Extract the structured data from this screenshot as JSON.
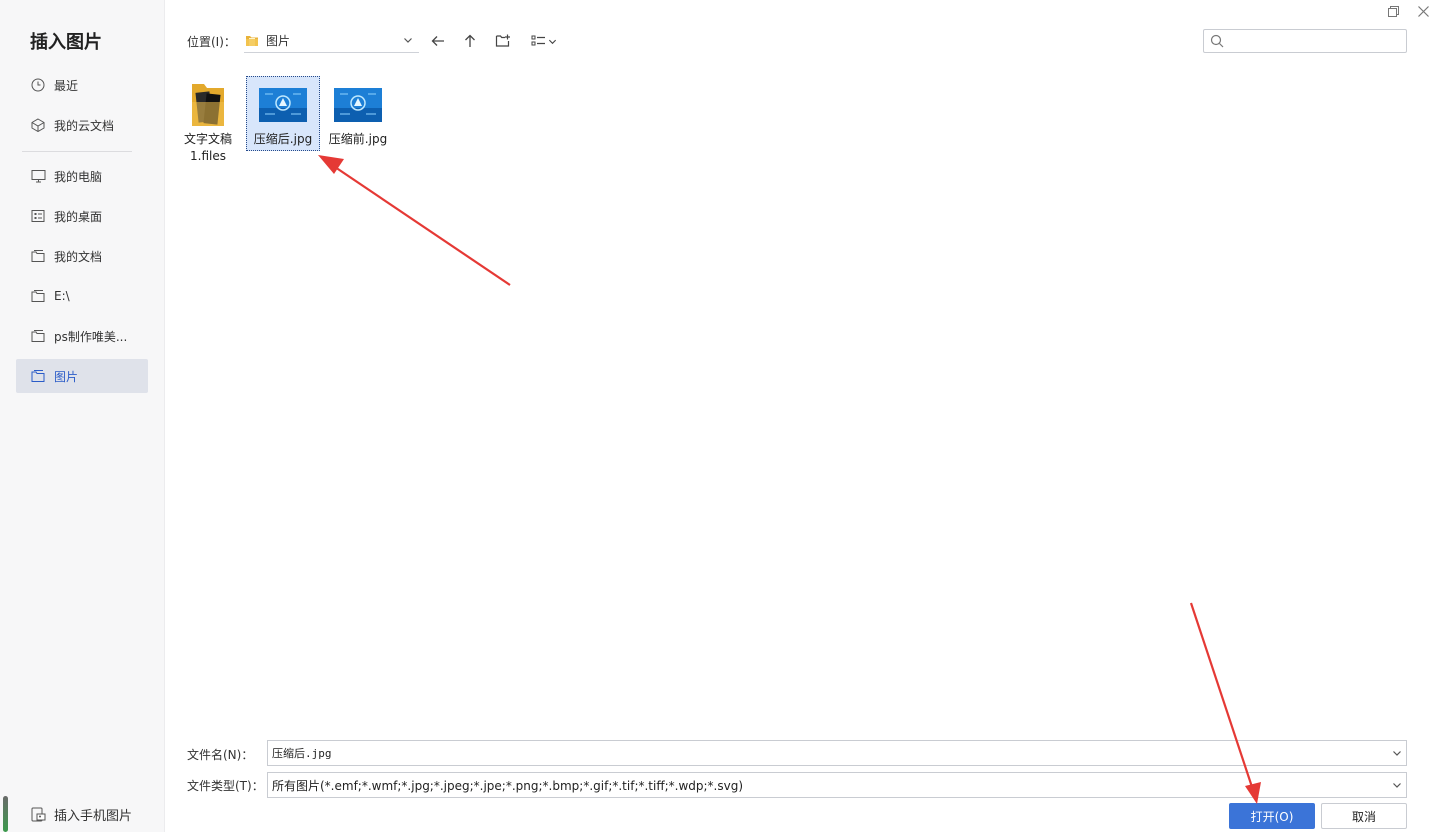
{
  "dialog": {
    "title": "插入图片"
  },
  "sidebar": {
    "items": [
      {
        "label": "最近",
        "icon": "clock-icon"
      },
      {
        "label": "我的云文档",
        "icon": "cloud-box-icon"
      },
      {
        "label": "我的电脑",
        "icon": "monitor-icon"
      },
      {
        "label": "我的桌面",
        "icon": "desktop-icon"
      },
      {
        "label": "我的文档",
        "icon": "folder-icon"
      },
      {
        "label": "E:\\",
        "icon": "folder-icon"
      },
      {
        "label": "ps制作唯美...",
        "icon": "folder-icon"
      },
      {
        "label": "图片",
        "icon": "folder-icon",
        "active": true
      }
    ],
    "mobile_label": "插入手机图片"
  },
  "toolbar": {
    "location_label": "位置(I)：",
    "current_folder": "图片"
  },
  "files": [
    {
      "name": "文字文稿1.files",
      "kind": "folder"
    },
    {
      "name": "压缩后.jpg",
      "kind": "image",
      "selected": true
    },
    {
      "name": "压缩前.jpg",
      "kind": "image"
    }
  ],
  "form": {
    "filename_label": "文件名(N)：",
    "filename_value": "压缩后.jpg",
    "filetype_label": "文件类型(T)：",
    "filetype_value": "所有图片(*.emf;*.wmf;*.jpg;*.jpeg;*.jpe;*.png;*.bmp;*.gif;*.tif;*.tiff;*.wdp;*.svg)"
  },
  "buttons": {
    "open": "打开(O)",
    "cancel": "取消"
  },
  "colors": {
    "accent": "#3b74d8",
    "annotation_arrow": "#e53935"
  }
}
